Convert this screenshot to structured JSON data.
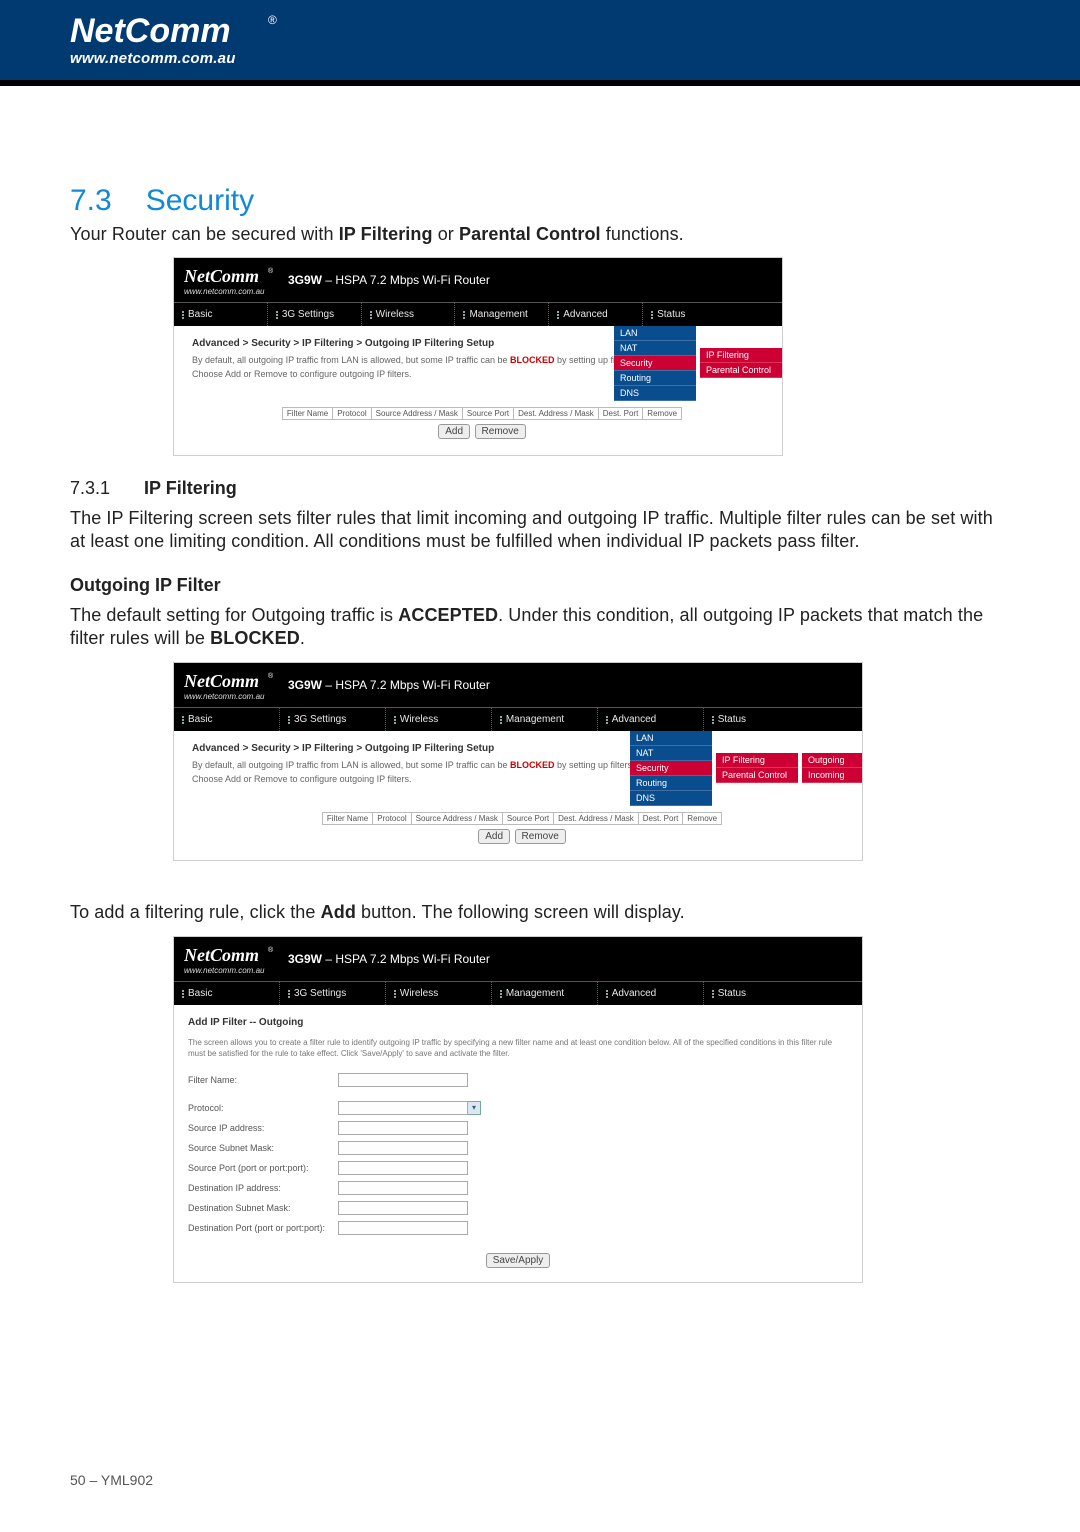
{
  "header": {
    "brand": "NetComm",
    "url": "www.netcomm.com.au"
  },
  "section": {
    "num": "7.3",
    "title": "Security",
    "lead_pre": "Your Router can be secured with ",
    "lead_b1": "IP Filtering",
    "lead_mid": " or ",
    "lead_b2": "Parental Control",
    "lead_post": " functions."
  },
  "shot_common": {
    "device_model": "3G9W",
    "device_desc": " – HSPA 7.2 Mbps Wi-Fi Router",
    "nav": [
      "Basic",
      "3G Settings",
      "Wireless",
      "Management",
      "Advanced",
      "Status"
    ],
    "advanced_menu": [
      "LAN",
      "NAT",
      "Security",
      "Routing",
      "DNS"
    ],
    "security_menu": [
      "IP Filtering",
      "Parental Control"
    ],
    "ipfilter_menu": [
      "Outgoing",
      "Incoming"
    ],
    "breadcrumb": "Advanced > Security > IP Filtering > Outgoing IP Filtering Setup",
    "desc_pre": "By default, all outgoing IP traffic from LAN is allowed, but some IP traffic can be ",
    "desc_red": "BLOCKED",
    "desc_post": " by setting up filters.",
    "desc2": "Choose Add or Remove to configure outgoing IP filters.",
    "table_headers": [
      "Filter Name",
      "Protocol",
      "Source Address / Mask",
      "Source Port",
      "Dest. Address / Mask",
      "Dest. Port",
      "Remove"
    ],
    "btn_add": "Add",
    "btn_remove": "Remove"
  },
  "sub1": {
    "num": "7.3.1",
    "title": "IP Filtering",
    "para": "The IP Filtering screen sets filter rules that limit incoming and outgoing  IP traffic.  Multiple filter rules can be set with at least one limiting condition.  All conditions must be fulfilled when individual IP packets pass filter."
  },
  "h3_out": "Outgoing IP Filter",
  "para_out_pre": "The default setting for Outgoing traffic is ",
  "para_out_b1": "ACCEPTED",
  "para_out_mid": ".  Under this condition, all outgoing IP packets that match the filter rules will be ",
  "para_out_b2": "BLOCKED",
  "para_out_post": ".",
  "para_add_pre": "To add a filtering rule, click the ",
  "para_add_b": "Add",
  "para_add_post": " button. The following screen will display.",
  "form": {
    "title": "Add IP Filter -- Outgoing",
    "note": "The screen allows you to create a filter rule to identify outgoing IP traffic by specifying a new filter name and at least one condition below. All of the specified conditions in this filter rule must be satisfied for the rule to take effect. Click 'Save/Apply' to save and activate the filter.",
    "fields": {
      "filter_name": "Filter Name:",
      "protocol": "Protocol:",
      "src_ip": "Source IP address:",
      "src_mask": "Source Subnet Mask:",
      "src_port": "Source Port (port or port:port):",
      "dst_ip": "Destination IP address:",
      "dst_mask": "Destination Subnet Mask:",
      "dst_port": "Destination Port (port or port:port):"
    },
    "save_btn": "Save/Apply"
  },
  "footer": "50 – YML902"
}
